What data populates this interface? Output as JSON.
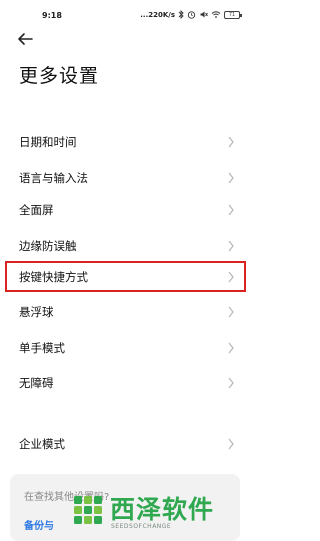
{
  "status_bar": {
    "time": "9:18",
    "network_speed": "...220K/s",
    "battery": "71",
    "icons": [
      "bluetooth-icon",
      "alarm-icon",
      "mute-icon",
      "wifi-icon",
      "battery-icon"
    ]
  },
  "header": {
    "back_icon": "arrow-left-icon",
    "title": "更多设置"
  },
  "settings": {
    "group1": [
      {
        "label": "日期和时间"
      },
      {
        "label": "语言与输入法"
      }
    ],
    "group2": [
      {
        "label": "全面屏"
      },
      {
        "label": "边缘防误触"
      },
      {
        "label": "按键快捷方式"
      },
      {
        "label": "悬浮球"
      },
      {
        "label": "单手模式"
      },
      {
        "label": "无障碍"
      }
    ],
    "group3": [
      {
        "label": "企业模式"
      }
    ]
  },
  "bottom_card": {
    "text": "在查找其他设置吗?",
    "link": "备份与"
  },
  "watermark": {
    "title": "西泽软件",
    "subtitle": "SEEDSOFCHANGE"
  },
  "colors": {
    "highlight": "#d8231f",
    "link": "#2b78e4",
    "watermark": "#2fa84f"
  }
}
